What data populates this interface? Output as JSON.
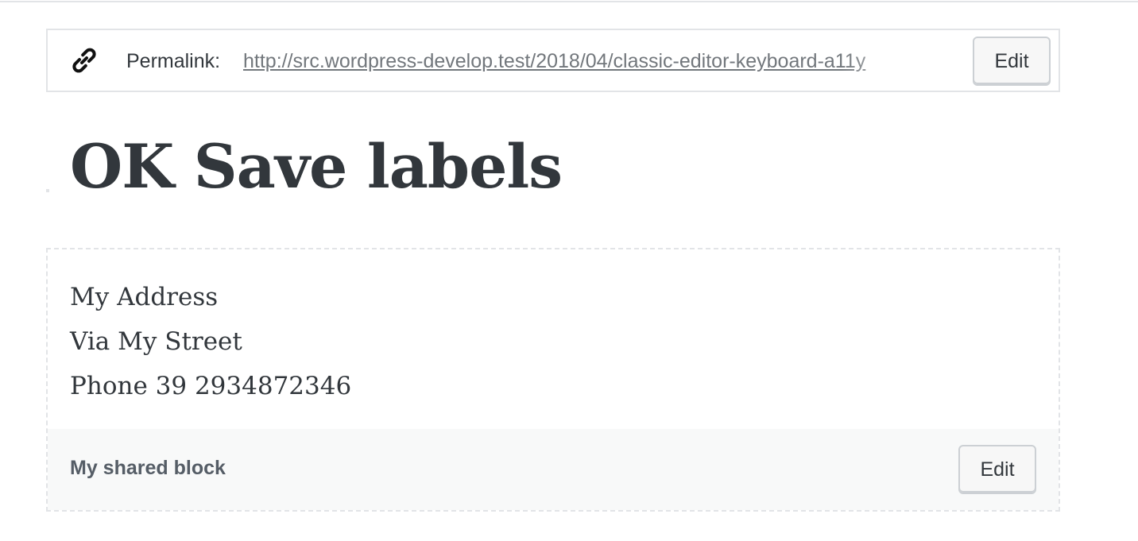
{
  "permalink": {
    "label": "Permalink:",
    "url": "http://src.wordpress-develop.test/2018/04/classic-editor-keyboard-a11y",
    "edit_label": "Edit",
    "icon": "link-icon"
  },
  "post": {
    "title": "OK Save labels"
  },
  "shared_block": {
    "lines": [
      "My Address",
      "Via My Street",
      "Phone 39 2934872346"
    ],
    "name": "My shared block",
    "edit_label": "Edit"
  }
}
